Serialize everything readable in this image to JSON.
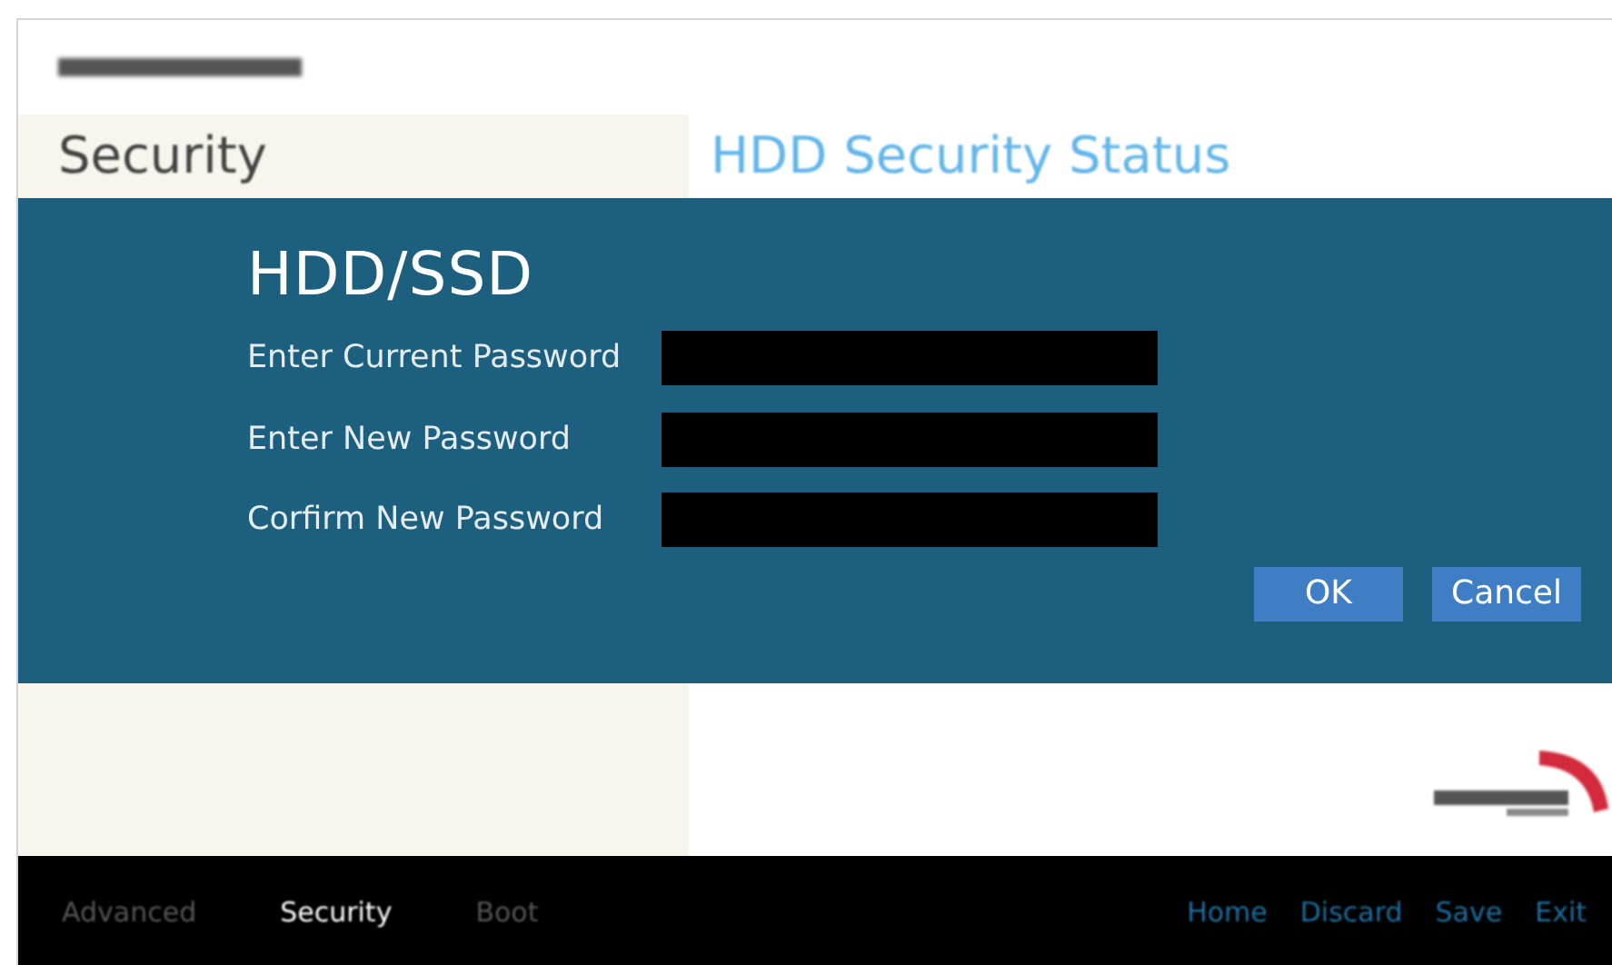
{
  "sidebar": {
    "title": "Security"
  },
  "content": {
    "title": "HDD Security Status"
  },
  "dialog": {
    "title": "HDD/SSD",
    "fields": [
      {
        "label": "Enter Current Password"
      },
      {
        "label": "Enter New Password"
      },
      {
        "label": "Corfirm New Password"
      }
    ],
    "buttons": [
      "OK",
      "Cancel"
    ]
  },
  "footer": {
    "tabs": [
      {
        "label": "Advanced",
        "selected": false
      },
      {
        "label": "Security",
        "selected": true
      },
      {
        "label": "Boot",
        "selected": false
      }
    ],
    "actions": [
      "Home",
      "Discard",
      "Save",
      "Exit"
    ]
  }
}
